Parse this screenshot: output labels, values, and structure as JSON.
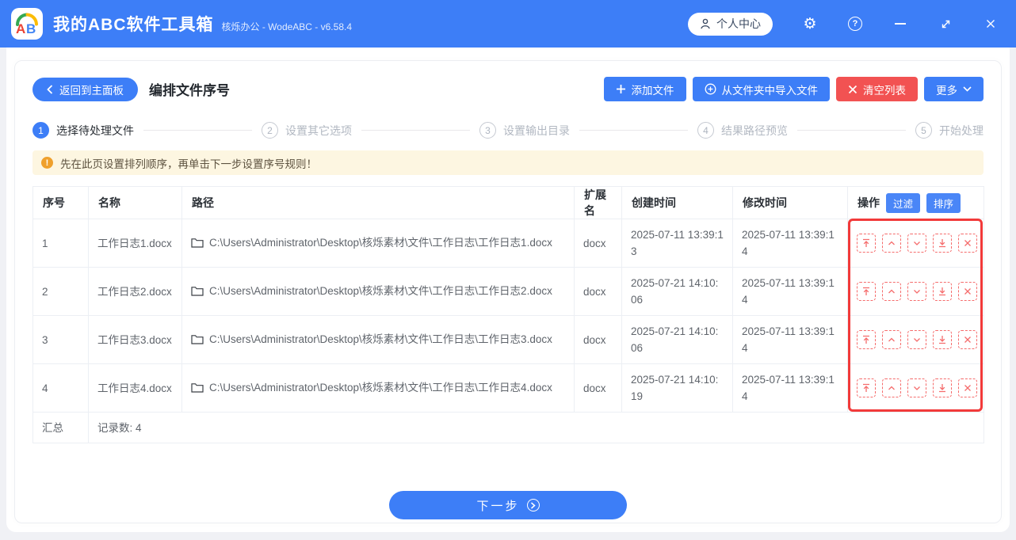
{
  "window": {
    "logo_text": "AB",
    "title": "我的ABC软件工具箱",
    "subtitle": "核烁办公 - WodeABC - v6.58.4",
    "user_center_label": "个人中心"
  },
  "toolbar": {
    "back_label": "返回到主面板",
    "page_title": "编排文件序号",
    "add_file_label": "添加文件",
    "import_folder_label": "从文件夹中导入文件",
    "clear_list_label": "清空列表",
    "more_label": "更多"
  },
  "steps": [
    {
      "num": "1",
      "label": "选择待处理文件",
      "active": true
    },
    {
      "num": "2",
      "label": "设置其它选项",
      "active": false
    },
    {
      "num": "3",
      "label": "设置输出目录",
      "active": false
    },
    {
      "num": "4",
      "label": "结果路径预览",
      "active": false
    },
    {
      "num": "5",
      "label": "开始处理",
      "active": false
    }
  ],
  "notice": "先在此页设置排列顺序，再单击下一步设置序号规则！",
  "table": {
    "headers": {
      "index": "序号",
      "name": "名称",
      "path": "路径",
      "ext": "扩展名",
      "created": "创建时间",
      "modified": "修改时间",
      "actions": "操作"
    },
    "filter_label": "过滤",
    "sort_label": "排序",
    "rows": [
      {
        "index": "1",
        "name": "工作日志1.docx",
        "path": "C:\\Users\\Administrator\\Desktop\\核烁素材\\文件\\工作日志\\工作日志1.docx",
        "ext": "docx",
        "created": "2025-07-11 13:39:13",
        "modified": "2025-07-11 13:39:14"
      },
      {
        "index": "2",
        "name": "工作日志2.docx",
        "path": "C:\\Users\\Administrator\\Desktop\\核烁素材\\文件\\工作日志\\工作日志2.docx",
        "ext": "docx",
        "created": "2025-07-21 14:10:06",
        "modified": "2025-07-11 13:39:14"
      },
      {
        "index": "3",
        "name": "工作日志3.docx",
        "path": "C:\\Users\\Administrator\\Desktop\\核烁素材\\文件\\工作日志\\工作日志3.docx",
        "ext": "docx",
        "created": "2025-07-21 14:10:06",
        "modified": "2025-07-11 13:39:14"
      },
      {
        "index": "4",
        "name": "工作日志4.docx",
        "path": "C:\\Users\\Administrator\\Desktop\\核烁素材\\文件\\工作日志\\工作日志4.docx",
        "ext": "docx",
        "created": "2025-07-21 14:10:19",
        "modified": "2025-07-11 13:39:14"
      }
    ],
    "summary_label": "汇总",
    "summary_value": "记录数: 4"
  },
  "footer": {
    "next_label": "下一步"
  },
  "icons": {
    "titlebar": [
      "person-icon",
      "gear-icon",
      "help-icon",
      "minimize-icon",
      "maximize-icon",
      "close-icon"
    ],
    "toolbar": [
      "chevron-left-icon",
      "plus-icon",
      "circle-plus-icon",
      "x-icon",
      "chevron-down-icon"
    ],
    "notice": "exclamation-icon",
    "path": "folder-icon",
    "row_actions": [
      "move-top-icon",
      "move-up-icon",
      "move-down-icon",
      "move-bottom-icon",
      "delete-icon"
    ],
    "next": "circle-arrow-right-icon"
  },
  "colors": {
    "accent_blue": "#3d7ef7",
    "danger_red": "#f25252",
    "action_red": "#f56c6c",
    "highlight_red": "#f23a3a",
    "warning_bg": "#fdf6e1",
    "warning_icon": "#efa02c",
    "header_text": "#2b3036",
    "body_text": "#5f646b",
    "muted_text": "#b2b8c2"
  }
}
